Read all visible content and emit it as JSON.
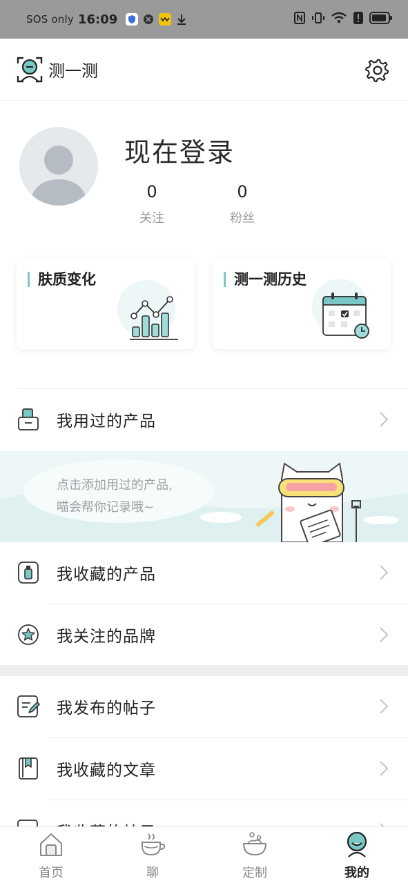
{
  "status_bar": {
    "carrier": "SOS only",
    "time": "16:09"
  },
  "header": {
    "title": "测一测",
    "icon": "face-scan-icon",
    "settings_icon": "gear-icon"
  },
  "profile": {
    "login_text": "现在登录",
    "following_count": "0",
    "following_label": "关注",
    "fans_count": "0",
    "fans_label": "粉丝"
  },
  "cards": [
    {
      "title": "肤质变化",
      "icon": "chart-icon"
    },
    {
      "title": "测一测历史",
      "icon": "calendar-icon"
    }
  ],
  "menu": {
    "used_products": "我用过的产品",
    "banner_line1": "点击添加用过的产品,",
    "banner_line2": "喵会帮你记录哦~",
    "fav_products": "我收藏的产品",
    "followed_brands": "我关注的品牌",
    "my_posts": "我发布的帖子",
    "fav_articles": "我收藏的文章",
    "fav_posts": "我收藏的帖子"
  },
  "bottom_nav": [
    {
      "label": "首页",
      "icon": "home-icon"
    },
    {
      "label": "聊",
      "icon": "coffee-cup-icon"
    },
    {
      "label": "定制",
      "icon": "custom-bowl-icon"
    },
    {
      "label": "我的",
      "icon": "profile-face-icon",
      "active": true
    }
  ],
  "colors": {
    "accent": "#79c8c6",
    "status_bar_bg": "#9a9a9a",
    "banner_bg": "#eef7f7"
  }
}
